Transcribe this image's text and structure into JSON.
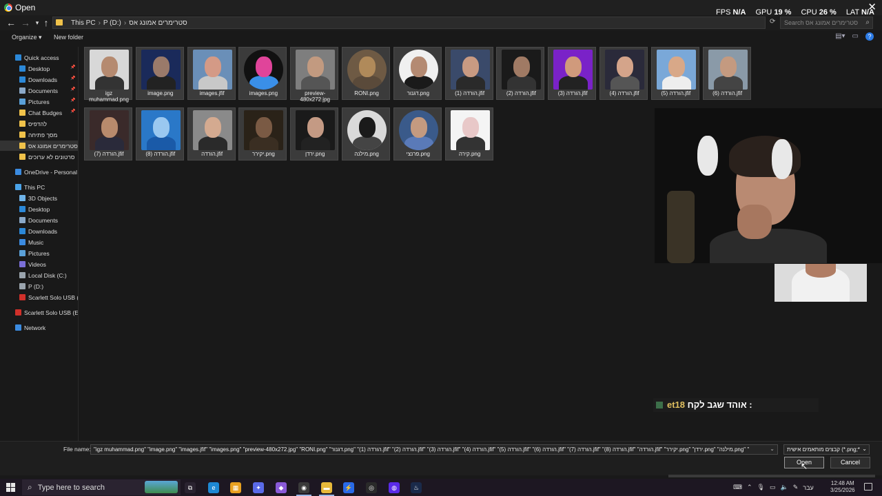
{
  "window": {
    "title": "Open",
    "close_glyph": "✕"
  },
  "overlay": {
    "fps_label": "FPS",
    "fps_value": "N/A",
    "gpu_label": "GPU",
    "gpu_value": "19 %",
    "cpu_label": "CPU",
    "cpu_value": "26 %",
    "lat_label": "LAT",
    "lat_value": "N/A"
  },
  "address": {
    "crumbs": [
      "This PC",
      "P (D:)",
      "סטרימרים אמונג אס"
    ],
    "separator": "›",
    "search_placeholder": "Search סטרימרים אמונג אס"
  },
  "toolbar": {
    "organize_label": "Organize ▾",
    "newfolder_label": "New folder"
  },
  "sidebar": {
    "items": [
      {
        "label": "Quick access",
        "icon": "star-icon",
        "color": "#2b88d8",
        "indent": 0,
        "pinned": false
      },
      {
        "label": "Desktop",
        "icon": "desktop-icon",
        "color": "#2b88d8",
        "indent": 1,
        "pinned": true
      },
      {
        "label": "Downloads",
        "icon": "download-icon",
        "color": "#2b88d8",
        "indent": 1,
        "pinned": true
      },
      {
        "label": "Documents",
        "icon": "document-icon",
        "color": "#8aa8c8",
        "indent": 1,
        "pinned": true
      },
      {
        "label": "Pictures",
        "icon": "pictures-icon",
        "color": "#5aa0d8",
        "indent": 1,
        "pinned": true
      },
      {
        "label": "Chat Budges",
        "icon": "folder-icon",
        "color": "#f0c24a",
        "indent": 1,
        "pinned": true
      },
      {
        "label": "להדפיס",
        "icon": "folder-icon",
        "color": "#f0c24a",
        "indent": 1,
        "pinned": false
      },
      {
        "label": "מסך פתיחה",
        "icon": "folder-icon",
        "color": "#f0c24a",
        "indent": 1,
        "pinned": false
      },
      {
        "label": "סטרימרים אמונג אס",
        "icon": "folder-icon",
        "color": "#f0c24a",
        "indent": 1,
        "pinned": false,
        "active": true
      },
      {
        "label": "סרטונים לא ערוכים",
        "icon": "folder-icon",
        "color": "#f0c24a",
        "indent": 1,
        "pinned": false
      },
      {
        "label": "OneDrive - Personal",
        "icon": "cloud-icon",
        "color": "#3b8be0",
        "indent": 0,
        "pinned": false,
        "gap": true
      },
      {
        "label": "This PC",
        "icon": "computer-icon",
        "color": "#4aa3e8",
        "indent": 0,
        "pinned": false,
        "gap": true
      },
      {
        "label": "3D Objects",
        "icon": "cube-icon",
        "color": "#6fb3e8",
        "indent": 1,
        "pinned": false
      },
      {
        "label": "Desktop",
        "icon": "desktop-icon",
        "color": "#2b88d8",
        "indent": 1,
        "pinned": false
      },
      {
        "label": "Documents",
        "icon": "document-icon",
        "color": "#8aa8c8",
        "indent": 1,
        "pinned": false
      },
      {
        "label": "Downloads",
        "icon": "download-icon",
        "color": "#2b88d8",
        "indent": 1,
        "pinned": false
      },
      {
        "label": "Music",
        "icon": "music-icon",
        "color": "#3b8be0",
        "indent": 1,
        "pinned": false
      },
      {
        "label": "Pictures",
        "icon": "pictures-icon",
        "color": "#5aa0d8",
        "indent": 1,
        "pinned": false
      },
      {
        "label": "Videos",
        "icon": "video-icon",
        "color": "#7a6fd8",
        "indent": 1,
        "pinned": false
      },
      {
        "label": "Local Disk (C:)",
        "icon": "disk-icon",
        "color": "#9aa4ad",
        "indent": 1,
        "pinned": false
      },
      {
        "label": "P (D:)",
        "icon": "disk-icon",
        "color": "#9aa4ad",
        "indent": 1,
        "pinned": false
      },
      {
        "label": "Scarlett Solo USB (E:",
        "icon": "scarlett-icon",
        "color": "#d0302a",
        "indent": 1,
        "pinned": false
      },
      {
        "label": "Scarlett Solo USB (E:)",
        "icon": "scarlett-icon",
        "color": "#d0302a",
        "indent": 0,
        "pinned": false,
        "gap": true
      },
      {
        "label": "Network",
        "icon": "network-icon",
        "color": "#3b8be0",
        "indent": 0,
        "pinned": false,
        "gap": true
      }
    ]
  },
  "files": [
    {
      "label": "igz muhammad.png",
      "bg": "#d8d8d8",
      "skin": "#b58a70",
      "shirt": "#333",
      "round": false
    },
    {
      "label": "image.png",
      "bg": "#1a2a5a",
      "skin": "#9a7a6a",
      "shirt": "#222",
      "round": false
    },
    {
      "label": "images.jfif",
      "bg": "#6a8fb8",
      "skin": "#d49a86",
      "shirt": "#c8c8c8",
      "round": false
    },
    {
      "label": "images.png",
      "bg": "#111",
      "skin": "#e0449a",
      "shirt": "#3a8fe8",
      "round": true
    },
    {
      "label": "preview-480x272.jpg",
      "bg": "#7e7e7e",
      "skin": "#c29a80",
      "shirt": "#555",
      "round": false
    },
    {
      "label": "RONI.png",
      "bg": "#6e5a44",
      "skin": "#b08a5a",
      "shirt": "#5a4a3a",
      "round": true
    },
    {
      "label": "דגנור.png",
      "bg": "#f0f0f0",
      "skin": "#b48a72",
      "shirt": "#1a1a1a",
      "round": true
    },
    {
      "label": "הורדה (1).jfif",
      "bg": "#3a4a6a",
      "skin": "#c89a82",
      "shirt": "#2a2a2a",
      "round": false
    },
    {
      "label": "הורדה (2).jfif",
      "bg": "#1a1a1a",
      "skin": "#a07a64",
      "shirt": "#333",
      "round": false
    },
    {
      "label": "הורדה (3).jfif",
      "bg": "#7a22c8",
      "skin": "#d09a7c",
      "shirt": "#222",
      "round": false
    },
    {
      "label": "הורדה (4).jfif",
      "bg": "#2a2a3a",
      "skin": "#d4a48a",
      "shirt": "#555",
      "round": false
    },
    {
      "label": "הורדה (5).jfif",
      "bg": "#7aa8d8",
      "skin": "#d8a888",
      "shirt": "#eee",
      "round": false
    },
    {
      "label": "הורדה (6).jfif",
      "bg": "#8a9aa8",
      "skin": "#c49a80",
      "shirt": "#444",
      "round": false
    },
    {
      "label": "הורדה (7).jfif",
      "bg": "#3a2a2a",
      "skin": "#b88a6c",
      "shirt": "#2a2a3a",
      "round": false
    },
    {
      "label": "הורדה (8).jfif",
      "bg": "#2a78c8",
      "skin": "#9ac8f0",
      "shirt": "#1a5aa8",
      "round": false
    },
    {
      "label": "הורדה.jfif",
      "bg": "#8a8a8a",
      "skin": "#d4aa90",
      "shirt": "#2a2a2a",
      "round": false
    },
    {
      "label": "יקירר.png",
      "bg": "#2a2218",
      "skin": "#7a5a44",
      "shirt": "#3a2e22",
      "round": false
    },
    {
      "label": "ירדן.png",
      "bg": "#1a1a1a",
      "skin": "#c49a84",
      "shirt": "#222",
      "round": false
    },
    {
      "label": "מילנה.png",
      "bg": "#dadada",
      "skin": "#1a1a1a",
      "shirt": "#444",
      "round": true
    },
    {
      "label": "פרנצי.png",
      "bg": "#3a5a8a",
      "skin": "#c49a80",
      "shirt": "#5a7ab8",
      "round": true
    },
    {
      "label": "קירה.png",
      "bg": "#f4f4f4",
      "skin": "#e8c8c8",
      "shirt": "#333",
      "round": false
    }
  ],
  "chat": {
    "name": "et18",
    "message": "אוהד שגב לקח :"
  },
  "bottom": {
    "filename_label": "File name:",
    "filename_value": "\"igz muhammad.png\" \"image.png\" \"images.jfif\" \"images.png\" \"preview-480x272.jpg\" \"RONI.png\" \"דגנור.png\" \"הורדה (1).jfif\" \"הורדה (2).jfif\" \"הורדה (3).jfif\" \"הורדה (4).jfif\" \"הורדה (5).jfif\" \"הורדה (6).jfif\" \"הורדה (7).jfif\" \"הורדה (8).jfif\" \"הורדה.jfif\" \"יקירר.png\" \"ירדן.png\" \"מילנה.png\" \"",
    "filetype_value": "קבצים מותאמים אישית (*.png;*.",
    "open_label": "Open",
    "cancel_label": "Cancel"
  },
  "taskbar": {
    "search_placeholder": "Type here to search",
    "apps": [
      {
        "name": "task-view-icon",
        "color": "#2a2330",
        "glyph": "⧉"
      },
      {
        "name": "edge-icon",
        "color": "#1e88d4",
        "glyph": "e"
      },
      {
        "name": "store-icon",
        "color": "#e8a020",
        "glyph": "▦"
      },
      {
        "name": "copilot-icon",
        "color": "#5a6ae8",
        "glyph": "✦"
      },
      {
        "name": "app-icon",
        "color": "#8a5ad8",
        "glyph": "◆"
      },
      {
        "name": "chrome-icon",
        "color": "#3a3a3a",
        "glyph": "◉"
      },
      {
        "name": "explorer-icon",
        "color": "#e8b83a",
        "glyph": "▬"
      },
      {
        "name": "app-icon",
        "color": "#2a6ae8",
        "glyph": "⚡"
      },
      {
        "name": "app-icon",
        "color": "#2a2a2a",
        "glyph": "◎"
      },
      {
        "name": "app-icon",
        "color": "#5a2ae8",
        "glyph": "◍"
      },
      {
        "name": "steam-icon",
        "color": "#1a2a4a",
        "glyph": "♨"
      }
    ],
    "tray_lang": "עבר",
    "time": "12:48 AM",
    "date": "3/25/2026"
  }
}
